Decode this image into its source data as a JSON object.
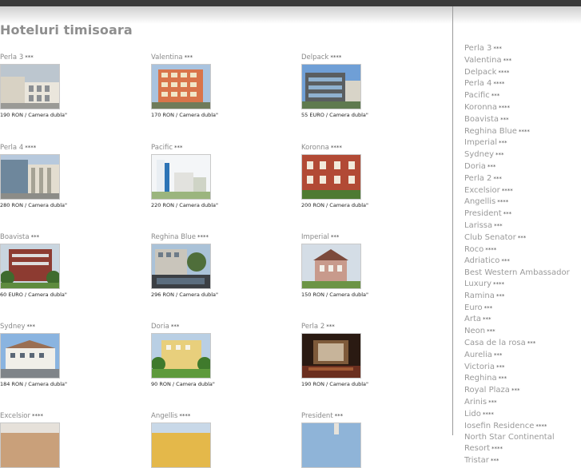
{
  "page_title": "Hoteluri timisoara",
  "colors": {
    "title": "#8e8e8e",
    "link": "#9a9a9a",
    "topbar": "#3a3a3a"
  },
  "hotels": [
    {
      "name": "Perla 3",
      "stars": "***",
      "price": "190 RON / Camera dubla\"",
      "thumb": "building-grey"
    },
    {
      "name": "Valentina",
      "stars": "***",
      "price": "170 RON / Camera dubla\"",
      "thumb": "building-orange"
    },
    {
      "name": "Delpack",
      "stars": "****",
      "price": "55 EURO / Camera dubla\"",
      "thumb": "building-modern"
    },
    {
      "name": "Perla 4",
      "stars": "****",
      "price": "280 RON / Camera dubla\"",
      "thumb": "building-glass"
    },
    {
      "name": "Pacific",
      "stars": "***",
      "price": "220 RON / Camera dubla\"",
      "thumb": "sign-white"
    },
    {
      "name": "Koronna",
      "stars": "****",
      "price": "200 RON / Camera dubla\"",
      "thumb": "building-red"
    },
    {
      "name": "Boavista",
      "stars": "***",
      "price": "60 EURO / Camera dubla\"",
      "thumb": "building-trees"
    },
    {
      "name": "Reghina Blue",
      "stars": "****",
      "price": "296 RON / Camera dubla\"",
      "thumb": "building-pool"
    },
    {
      "name": "Imperial",
      "stars": "***",
      "price": "150 RON / Camera dubla\"",
      "thumb": "villa"
    },
    {
      "name": "Sydney",
      "stars": "***",
      "price": "184 RON / Camera dubla\"",
      "thumb": "building-white"
    },
    {
      "name": "Doria",
      "stars": "***",
      "price": "90 RON / Camera dubla\"",
      "thumb": "building-yellow"
    },
    {
      "name": "Perla 2",
      "stars": "***",
      "price": "190 RON / Camera dubla\"",
      "thumb": "interior"
    },
    {
      "name": "Excelsior",
      "stars": "****",
      "price": "",
      "thumb": "partial-1"
    },
    {
      "name": "Angellis",
      "stars": "****",
      "price": "",
      "thumb": "partial-2"
    },
    {
      "name": "President",
      "stars": "***",
      "price": "",
      "thumb": "partial-3"
    }
  ],
  "sidebar": [
    {
      "name": "Perla 3",
      "stars": "***"
    },
    {
      "name": "Valentina",
      "stars": "***"
    },
    {
      "name": "Delpack",
      "stars": "****"
    },
    {
      "name": "Perla 4",
      "stars": "****"
    },
    {
      "name": "Pacific",
      "stars": "***"
    },
    {
      "name": "Koronna",
      "stars": "****"
    },
    {
      "name": "Boavista",
      "stars": "***"
    },
    {
      "name": "Reghina Blue",
      "stars": "****"
    },
    {
      "name": "Imperial",
      "stars": "***"
    },
    {
      "name": "Sydney",
      "stars": "***"
    },
    {
      "name": "Doria",
      "stars": "***"
    },
    {
      "name": "Perla 2",
      "stars": "***"
    },
    {
      "name": "Excelsior",
      "stars": "****"
    },
    {
      "name": "Angellis",
      "stars": "****"
    },
    {
      "name": "President",
      "stars": "***"
    },
    {
      "name": "Larissa",
      "stars": "***"
    },
    {
      "name": "Club Senator",
      "stars": "***"
    },
    {
      "name": "Roco",
      "stars": "****"
    },
    {
      "name": "Adriatico",
      "stars": "***"
    },
    {
      "name": "Best Western Ambassador",
      "stars": ""
    },
    {
      "name": "Luxury",
      "stars": "****"
    },
    {
      "name": "Ramina",
      "stars": "***"
    },
    {
      "name": "Euro",
      "stars": "***"
    },
    {
      "name": "Arta",
      "stars": "***"
    },
    {
      "name": "Neon",
      "stars": "***"
    },
    {
      "name": "Casa de la rosa",
      "stars": "***"
    },
    {
      "name": "Aurelia",
      "stars": "***"
    },
    {
      "name": "Victoria",
      "stars": "***"
    },
    {
      "name": "Reghina",
      "stars": "***"
    },
    {
      "name": "Royal Plaza",
      "stars": "***"
    },
    {
      "name": "Arinis",
      "stars": "***"
    },
    {
      "name": "Lido",
      "stars": "****"
    },
    {
      "name": "Iosefin Residence",
      "stars": "****"
    },
    {
      "name": "North Star Continental Resort",
      "stars": "****"
    },
    {
      "name": "Tristar",
      "stars": "***"
    }
  ]
}
